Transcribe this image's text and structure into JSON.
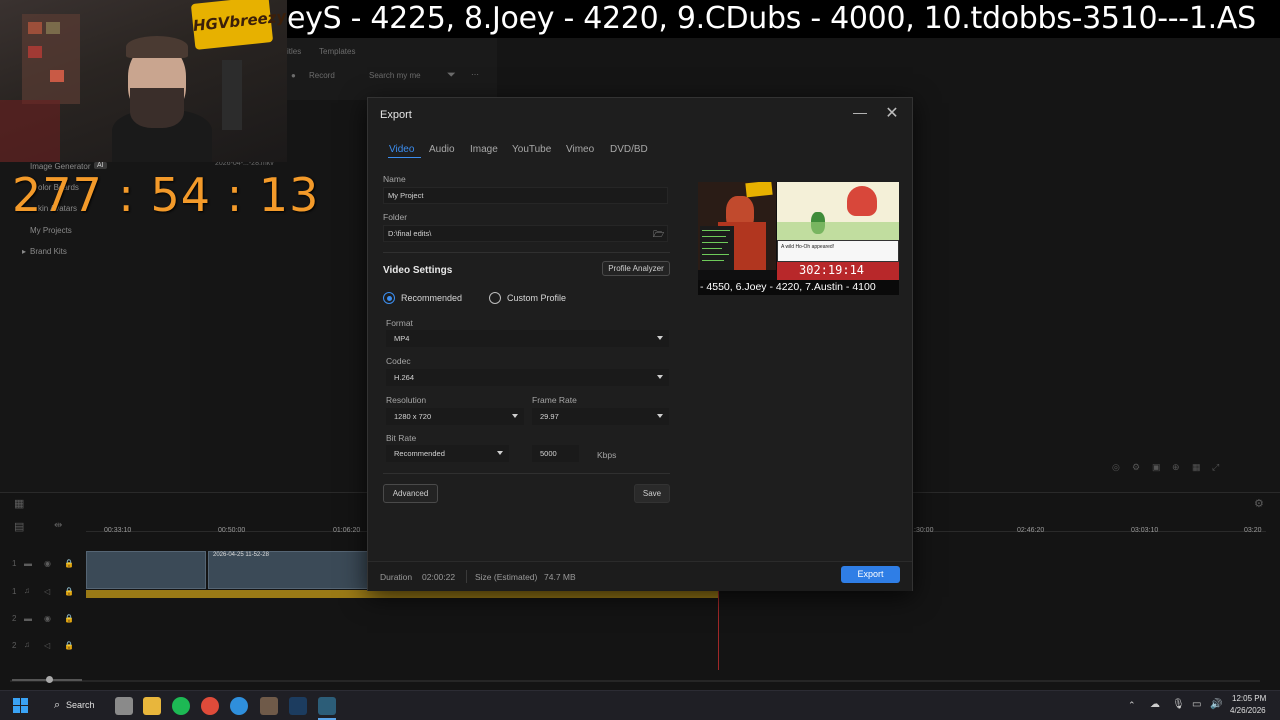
{
  "stream": {
    "logo_text": "HGVbreezy",
    "ticker": "eyS - 4225, 8.Joey - 4220, 9.CDubs - 4000, 10.tdobbs-3510---1.AS",
    "timer": "277 : 54 : 13"
  },
  "background_app": {
    "toolbar": {
      "item1": "itles",
      "item2": "Templates",
      "record": "Record",
      "search_placeholder": "Search my me"
    },
    "left_panel": {
      "image_generator": "Image Generator",
      "ai_badge": "AI",
      "color_boards": "olor Boards",
      "avatars": "kin Avatars",
      "my_projects": "My Projects",
      "brand_kits": "Brand Kits",
      "file_date": "2026-04-...-28.mkv"
    },
    "timeline": {
      "ruler": [
        "00:33:10",
        "00:50:00",
        "01:06:20",
        ":30:00",
        "02:46:20",
        "03:03:10",
        "03:20"
      ],
      "clip_label": "2026-04-25 11-52-28"
    }
  },
  "taskbar": {
    "search_label": "Search",
    "time": "12:05 PM",
    "date": "4/26/2026"
  },
  "export_dialog": {
    "title": "Export",
    "tabs": [
      "Video",
      "Audio",
      "Image",
      "YouTube",
      "Vimeo",
      "DVD/BD"
    ],
    "active_tab": "Video",
    "name_label": "Name",
    "name_value": "My Project",
    "folder_label": "Folder",
    "folder_value": "D:\\final edits\\",
    "video_settings_title": "Video Settings",
    "profile_analyzer": "Profile Analyzer",
    "radio_recommended": "Recommended",
    "radio_custom": "Custom Profile",
    "format_label": "Format",
    "format_value": "MP4",
    "codec_label": "Codec",
    "codec_value": "H.264",
    "resolution_label": "Resolution",
    "resolution_value": "1280 x 720",
    "frame_rate_label": "Frame Rate",
    "frame_rate_value": "29.97",
    "bit_rate_label": "Bit Rate",
    "bit_rate_mode": "Recommended",
    "bit_rate_value": "5000",
    "bit_rate_unit": "Kbps",
    "advanced_button": "Advanced",
    "save_button": "Save",
    "duration_label": "Duration",
    "duration_value": "02:00:22",
    "size_label": "Size (Estimated)",
    "size_value": "74.7 MB",
    "export_button": "Export",
    "preview": {
      "timer": "302:19:14",
      "ticker": "- 4550, 6.Joey - 4220, 7.Austin - 4100",
      "game_text": "A wild Ho-Oh appeared!"
    }
  },
  "colors": {
    "accent": "#2f7ee6",
    "timer_orange": "#f39a2a",
    "dialog_bg": "#1e1e1e"
  }
}
